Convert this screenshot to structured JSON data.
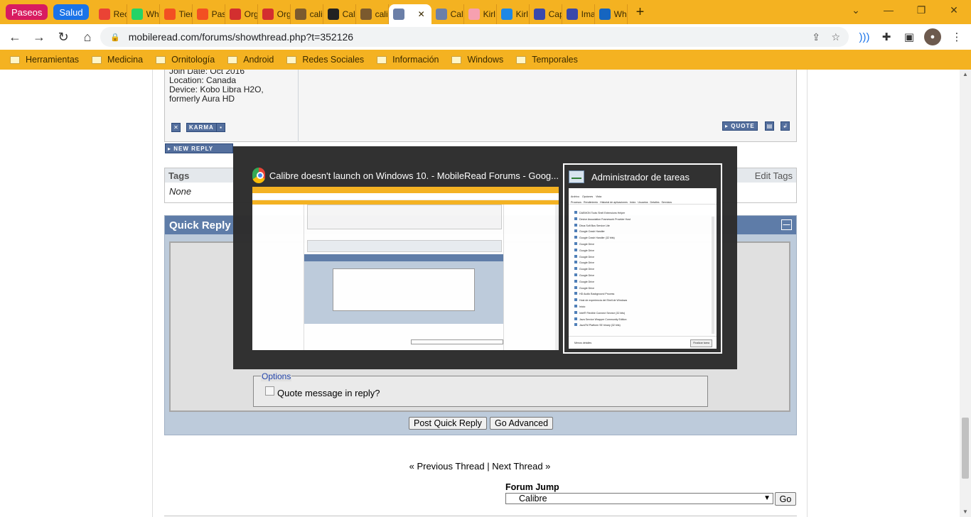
{
  "tabs": {
    "groups": [
      {
        "label": "Paseos",
        "color": "#d81b60"
      },
      {
        "label": "Salud",
        "color": "#1a73e8"
      }
    ],
    "items": [
      {
        "label": "Rec",
        "fav": "#ea4335"
      },
      {
        "label": "Wh",
        "fav": "#25d366"
      },
      {
        "label": "Tier",
        "fav": "#f25022"
      },
      {
        "label": "Pas",
        "fav": "#f25022"
      },
      {
        "label": "Org",
        "fav": "#d32f2f"
      },
      {
        "label": "Org",
        "fav": "#d32f2f"
      },
      {
        "label": "cali",
        "fav": "#7b5a2e"
      },
      {
        "label": "Cali",
        "fav": "#222222"
      },
      {
        "label": "cali",
        "fav": "#7b5a2e"
      },
      {
        "label": "",
        "fav": "#6b7fa8",
        "active": true
      },
      {
        "label": "Cali",
        "fav": "#6b7fa8"
      },
      {
        "label": "Kirl",
        "fav": "#f6a0b0"
      },
      {
        "label": "Kirl",
        "fav": "#1e88e5"
      },
      {
        "label": "Cap",
        "fav": "#3949ab"
      },
      {
        "label": "Ima",
        "fav": "#3949ab"
      },
      {
        "label": "Wh",
        "fav": "#1565c0"
      }
    ]
  },
  "toolbar": {
    "url": "mobileread.com/forums/showthread.php?t=352126"
  },
  "bookmarks": [
    "Herramientas",
    "Medicina",
    "Ornitología",
    "Android",
    "Redes Sociales",
    "Información",
    "Windows",
    "Temporales"
  ],
  "post": {
    "join": "Join Date: Oct 2016",
    "location": "Location: Canada",
    "device1": "Device: Kobo Libra H2O,",
    "device2": "formerly Aura HD",
    "karma": "KARMA",
    "quote": "QUOTE",
    "new_reply": "NEW REPLY"
  },
  "tags": {
    "title": "Tags",
    "edit": "Edit Tags",
    "value": "None"
  },
  "quick_reply": {
    "title": "Quick Reply",
    "options_legend": "Options",
    "quote_label": "Quote message in reply?",
    "post_button": "Post Quick Reply",
    "advanced_button": "Go Advanced"
  },
  "thread_nav": {
    "prev": "Previous Thread",
    "sep": "|",
    "next": "Next Thread"
  },
  "forum_jump": {
    "label": "Forum Jump",
    "selected": "Calibre",
    "go": "Go"
  },
  "switcher": {
    "chrome_title": "Calibre doesn't launch on Windows 10. - MobileRead Forums - Goog...",
    "taskmgr_title": "Administrador de tareas",
    "taskmgr_rows": [
      "DAEMON Tools Shell Extensions Helper",
      "Device Association Framework Provider Host",
      "Dbus Soft Bus Service Lite",
      "Google Crash Handler",
      "Google Crash Handler (32 bits)",
      "Google Drive",
      "Google Drive",
      "Google Drive",
      "Google Drive",
      "Google Drive",
      "Google Drive",
      "Google Drive",
      "Google Drive",
      "HD Audio Background Process",
      "Host de experiencia del Shell de Windows",
      "Inicio",
      "Intel® Flexible Connect Service (32 bits)",
      "Java Service Wrapper Community Edition",
      "JavaTM Platform SE binary (32 bits)"
    ],
    "taskmgr_tabs": [
      "Procesos",
      "Rendimiento",
      "Historial de aplicaciones",
      "Inicio",
      "Usuarios",
      "Detalles",
      "Servicios"
    ],
    "taskmgr_menu": [
      "Archivo",
      "Opciones",
      "Vista"
    ],
    "taskmgr_footer_less": "Menos detalles",
    "taskmgr_footer_end": "Finalizar tarea"
  }
}
